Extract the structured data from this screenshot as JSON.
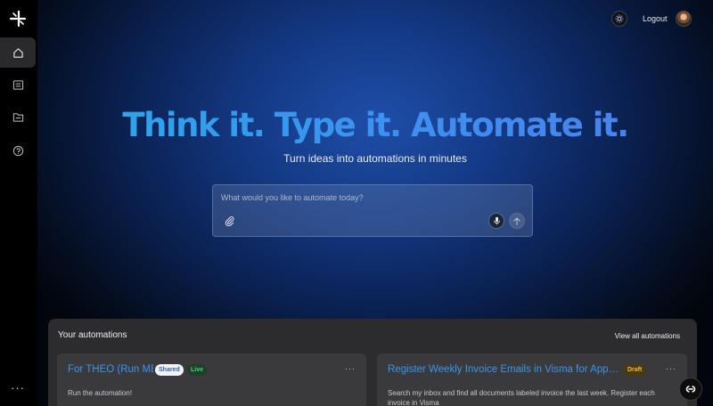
{
  "header": {
    "logout_label": "Logout",
    "theme_icon": "sun-icon",
    "avatar": "user-avatar"
  },
  "sidebar": {
    "logo": "sparkle-logo-icon",
    "items": [
      {
        "name": "home",
        "icon": "home-icon",
        "active": true
      },
      {
        "name": "list",
        "icon": "list-icon",
        "active": false
      },
      {
        "name": "folder",
        "icon": "folder-icon",
        "active": false
      },
      {
        "name": "help",
        "icon": "help-icon",
        "active": false
      }
    ],
    "more_label": "···"
  },
  "hero": {
    "title": "Think it. Type it. Automate it.",
    "subtitle": "Turn ideas into automations in minutes"
  },
  "prompt": {
    "placeholder": "What would you like to automate today?",
    "value": ""
  },
  "automations": {
    "title": "Your automations",
    "view_all_label": "View all automations",
    "cards": [
      {
        "title": "For THEO (Run ME)",
        "badges": [
          "Shared",
          "Live"
        ],
        "description": "Run the automation!",
        "menu_label": "···"
      },
      {
        "title": "Register Weekly Invoice Emails in Visma for Approv...",
        "badges": [
          "Draft"
        ],
        "description": "Search my inbox and find all documents labeled invoice the last week. Register each invoice in Visma",
        "menu_label": "···"
      }
    ]
  },
  "colors": {
    "accent": "#3b94ee",
    "live": "#4bd07c",
    "draft": "#f2b53a",
    "panel": "#2c2c2e"
  }
}
